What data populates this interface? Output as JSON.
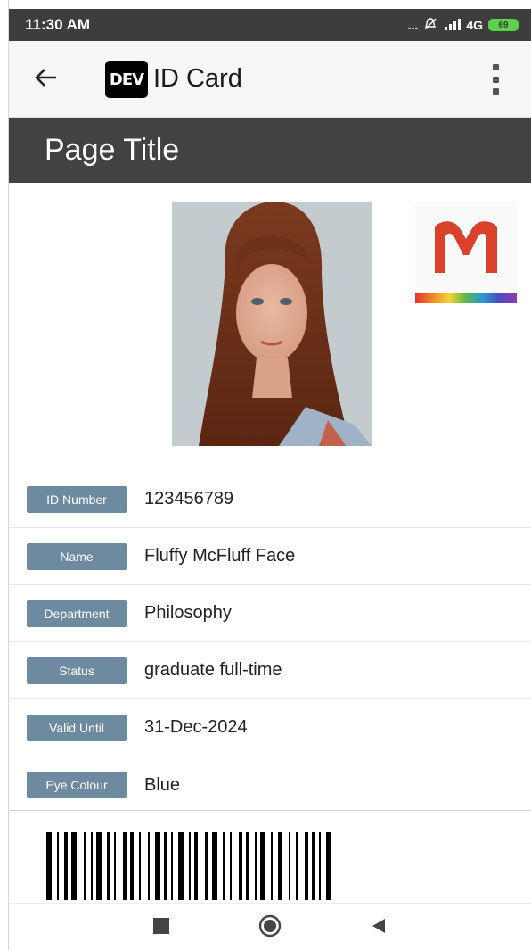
{
  "status_bar": {
    "time": "11:30 AM",
    "signal_text": "... ",
    "network": "4G",
    "battery_level": "69",
    "icons": [
      "mute-icon",
      "signal-icon",
      "battery-icon"
    ]
  },
  "app_bar": {
    "logo_text": "DEV",
    "title": "ID Card",
    "icons": [
      "back-arrow-icon",
      "overflow-menu-icon"
    ]
  },
  "page": {
    "title": "Page Title"
  },
  "card": {
    "logo_letter": "M",
    "fields": [
      {
        "label": "ID Number",
        "value": "123456789"
      },
      {
        "label": "Name",
        "value": "Fluffy McFluff Face"
      },
      {
        "label": "Department",
        "value": "Philosophy"
      },
      {
        "label": "Status",
        "value": "graduate full-time"
      },
      {
        "label": "Valid Until",
        "value": "31-Dec-2024"
      },
      {
        "label": "Eye Colour",
        "value": "Blue"
      }
    ]
  },
  "colors": {
    "status_bar": "#3d3d3d",
    "title_band": "#424242",
    "label_bg": "#6e8aa1",
    "logo_red": "#d9412b"
  },
  "nav_bar": {
    "icons": [
      "recents-square-icon",
      "home-circle-icon",
      "back-triangle-icon"
    ]
  }
}
